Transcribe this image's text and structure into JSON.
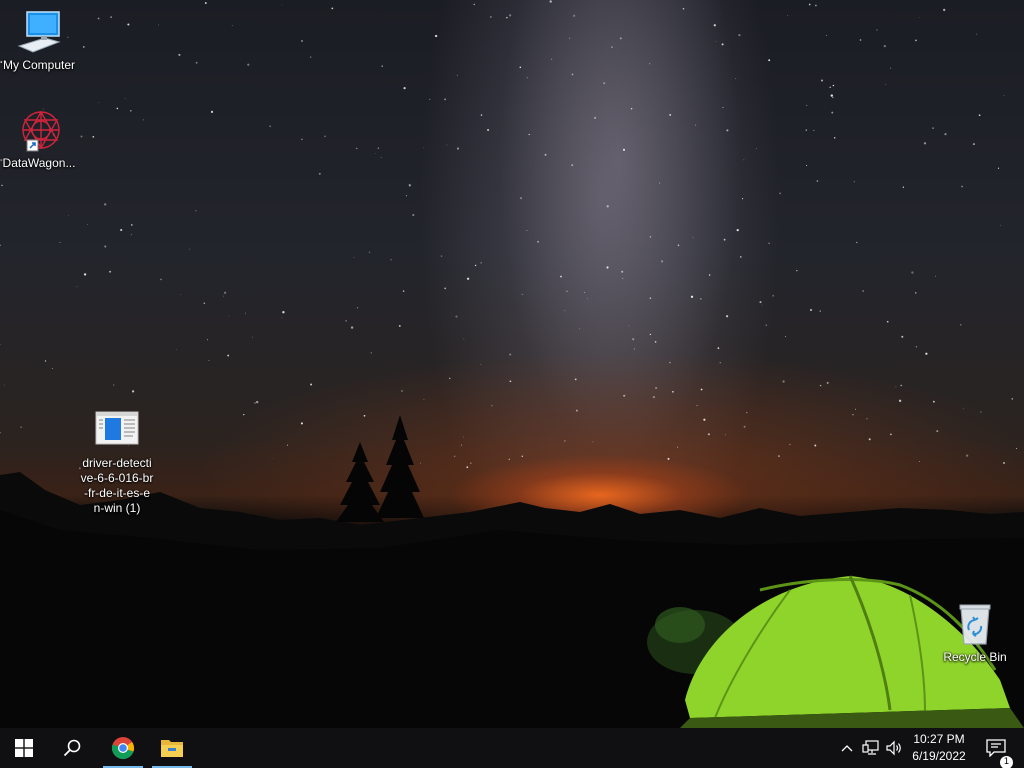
{
  "desktop": {
    "icons": [
      {
        "label": "My Computer",
        "icon": "computer-icon"
      },
      {
        "label": "DataWagon...",
        "icon": "datawagon-shortcut-icon"
      },
      {
        "label": "driver-detective-6-6-016-br-fr-de-it-es-en-win (1)",
        "label_lines": [
          "driver-detecti",
          "ve-6-6-016-br",
          "-fr-de-it-es-e",
          "n-win (1)"
        ],
        "icon": "installer-file-icon"
      },
      {
        "label": "Recycle Bin",
        "icon": "recycle-bin-icon"
      }
    ]
  },
  "taskbar": {
    "start_icon": "windows-start-icon",
    "search_icon": "search-icon",
    "pinned": [
      {
        "name": "Google Chrome",
        "icon": "chrome-icon",
        "active": true
      },
      {
        "name": "File Explorer",
        "icon": "file-explorer-icon",
        "active": true
      }
    ],
    "tray": {
      "chevron_icon": "chevron-up-icon",
      "network_icon": "network-icon",
      "volume_icon": "volume-icon",
      "time": "10:27 PM",
      "date": "6/19/2022",
      "notification_count": "1"
    }
  },
  "colors": {
    "taskbar_bg": "#101012",
    "active_indicator": "#76b9ed",
    "tent_green": "#8fd42a",
    "horizon_orange": "#ff6e1e"
  }
}
